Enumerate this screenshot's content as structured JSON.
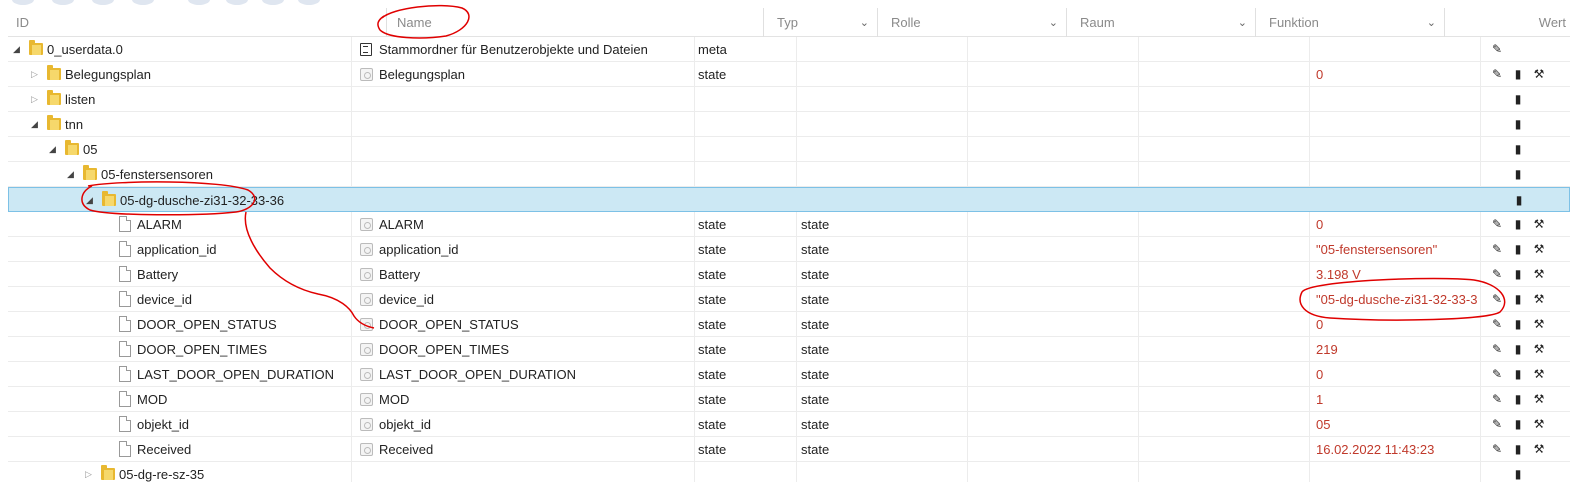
{
  "columns": {
    "id": "ID",
    "name": "Name",
    "typ": "Typ",
    "rolle": "Rolle",
    "raum": "Raum",
    "funktion": "Funktion",
    "wert": "Wert"
  },
  "rows": [
    {
      "id": "0_userdata.0",
      "name": "Stammordner für Benutzerobjekte und Dateien",
      "typ": "meta",
      "rolle": "",
      "wert": "",
      "icon": "folder-icon",
      "nameIcon": "meta-icon",
      "depth": 0,
      "expander": "open",
      "buttons": [
        "edit"
      ],
      "selected": false
    },
    {
      "id": "Belegungsplan",
      "name": "Belegungsplan",
      "typ": "state",
      "rolle": "",
      "wert": "0",
      "icon": "folder-icon",
      "nameIcon": "state-icon",
      "depth": 1,
      "expander": "closed",
      "buttons": [
        "edit",
        "delete",
        "wrench"
      ],
      "selected": false
    },
    {
      "id": "listen",
      "name": "",
      "typ": "",
      "rolle": "",
      "wert": "",
      "icon": "folder-icon",
      "nameIcon": "",
      "depth": 1,
      "expander": "closed",
      "buttons": [
        "delete"
      ],
      "selected": false
    },
    {
      "id": "tnn",
      "name": "",
      "typ": "",
      "rolle": "",
      "wert": "",
      "icon": "folder-icon",
      "nameIcon": "",
      "depth": 1,
      "expander": "open",
      "buttons": [
        "delete"
      ],
      "selected": false
    },
    {
      "id": "05",
      "name": "",
      "typ": "",
      "rolle": "",
      "wert": "",
      "icon": "folder-icon",
      "nameIcon": "",
      "depth": 2,
      "expander": "open",
      "buttons": [
        "delete"
      ],
      "selected": false
    },
    {
      "id": "05-fenstersensoren",
      "name": "",
      "typ": "",
      "rolle": "",
      "wert": "",
      "icon": "folder-icon",
      "nameIcon": "",
      "depth": 3,
      "expander": "open",
      "buttons": [
        "delete"
      ],
      "selected": false
    },
    {
      "id": "05-dg-dusche-zi31-32-33-36",
      "name": "",
      "typ": "",
      "rolle": "",
      "wert": "",
      "icon": "folder-icon",
      "nameIcon": "",
      "depth": 4,
      "expander": "open",
      "buttons": [
        "delete"
      ],
      "selected": true
    },
    {
      "id": "ALARM",
      "name": "ALARM",
      "typ": "state",
      "rolle": "state",
      "wert": "0",
      "icon": "file-icon",
      "nameIcon": "state-icon",
      "depth": 5,
      "expander": "",
      "buttons": [
        "edit",
        "delete",
        "wrench"
      ],
      "selected": false
    },
    {
      "id": "application_id",
      "name": "application_id",
      "typ": "state",
      "rolle": "state",
      "wert": "\"05-fenstersensoren\"",
      "icon": "file-icon",
      "nameIcon": "state-icon",
      "depth": 5,
      "expander": "",
      "buttons": [
        "edit",
        "delete",
        "wrench"
      ],
      "selected": false
    },
    {
      "id": "Battery",
      "name": "Battery",
      "typ": "state",
      "rolle": "state",
      "wert": "3.198 V",
      "icon": "file-icon",
      "nameIcon": "state-icon",
      "depth": 5,
      "expander": "",
      "buttons": [
        "edit",
        "delete",
        "wrench"
      ],
      "selected": false
    },
    {
      "id": "device_id",
      "name": "device_id",
      "typ": "state",
      "rolle": "state",
      "wert": "\"05-dg-dusche-zi31-32-33-3",
      "icon": "file-icon",
      "nameIcon": "state-icon",
      "depth": 5,
      "expander": "",
      "buttons": [
        "edit",
        "delete",
        "wrench"
      ],
      "selected": false
    },
    {
      "id": "DOOR_OPEN_STATUS",
      "name": "DOOR_OPEN_STATUS",
      "typ": "state",
      "rolle": "state",
      "wert": "0",
      "icon": "file-icon",
      "nameIcon": "state-icon",
      "depth": 5,
      "expander": "",
      "buttons": [
        "edit",
        "delete",
        "wrench"
      ],
      "selected": false
    },
    {
      "id": "DOOR_OPEN_TIMES",
      "name": "DOOR_OPEN_TIMES",
      "typ": "state",
      "rolle": "state",
      "wert": "219",
      "icon": "file-icon",
      "nameIcon": "state-icon",
      "depth": 5,
      "expander": "",
      "buttons": [
        "edit",
        "delete",
        "wrench"
      ],
      "selected": false
    },
    {
      "id": "LAST_DOOR_OPEN_DURATION",
      "name": "LAST_DOOR_OPEN_DURATION",
      "typ": "state",
      "rolle": "state",
      "wert": "0",
      "icon": "file-icon",
      "nameIcon": "state-icon",
      "depth": 5,
      "expander": "",
      "buttons": [
        "edit",
        "delete",
        "wrench"
      ],
      "selected": false
    },
    {
      "id": "MOD",
      "name": "MOD",
      "typ": "state",
      "rolle": "state",
      "wert": "1",
      "icon": "file-icon",
      "nameIcon": "state-icon",
      "depth": 5,
      "expander": "",
      "buttons": [
        "edit",
        "delete",
        "wrench"
      ],
      "selected": false
    },
    {
      "id": "objekt_id",
      "name": "objekt_id",
      "typ": "state",
      "rolle": "state",
      "wert": "05",
      "icon": "file-icon",
      "nameIcon": "state-icon",
      "depth": 5,
      "expander": "",
      "buttons": [
        "edit",
        "delete",
        "wrench"
      ],
      "selected": false
    },
    {
      "id": "Received",
      "name": "Received",
      "typ": "state",
      "rolle": "state",
      "wert": "16.02.2022 11:43:23",
      "icon": "file-icon",
      "nameIcon": "state-icon",
      "depth": 5,
      "expander": "",
      "buttons": [
        "edit",
        "delete",
        "wrench"
      ],
      "selected": false
    },
    {
      "id": "05-dg-re-sz-35",
      "name": "",
      "typ": "",
      "rolle": "",
      "wert": "",
      "icon": "folder-icon",
      "nameIcon": "",
      "depth": 4,
      "expander": "closed",
      "buttons": [
        "delete"
      ],
      "selected": false
    }
  ],
  "colors": {
    "value_text": "#c0392b",
    "selected_row_bg": "#cce8f4",
    "selected_row_border": "#7dc1e6",
    "folder": "#e8b830",
    "annotation": "#e00000"
  }
}
